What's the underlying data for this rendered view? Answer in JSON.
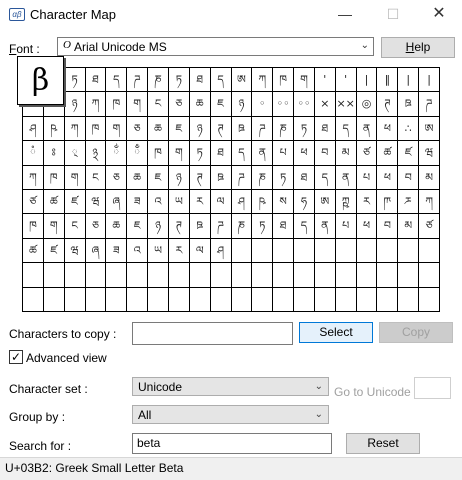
{
  "window": {
    "title": "Character Map",
    "icon_label": "αβ",
    "minimize_glyph": "—",
    "maximize_glyph": "☐",
    "close_glyph": "✕"
  },
  "font": {
    "label": "Font :",
    "label_accel": "F",
    "label_rest": "ont :",
    "type_glyph": "O",
    "selected": "Arial Unicode MS",
    "help_label": "Help",
    "help_accel": "H",
    "help_rest": "elp"
  },
  "grid": {
    "zoomed_char": "β",
    "cells": [
      "",
      "",
      "ཏ",
      "ཐ",
      "ད",
      "ཌ",
      "ཎ",
      "ཏ",
      "ཐ",
      "ད",
      "ཨ",
      "ཀ",
      "ཁ",
      "ག",
      "'",
      "'",
      "|",
      "‖",
      "|",
      "|",
      "",
      "",
      "ཉ",
      "ཀ",
      "ཁ",
      "ག",
      "ང",
      "ཅ",
      "ཆ",
      "ཇ",
      "ཉ",
      "◦",
      "◦◦",
      "◦◦",
      "×",
      "××",
      "◎",
      "ཊ",
      "ཋ",
      "ཌ",
      "ཤ",
      "ཥ",
      "ཀ",
      "ཁ",
      "ག",
      "ཅ",
      "ཆ",
      "ཇ",
      "ཉ",
      "ཊ",
      "ཋ",
      "ཌ",
      "ཎ",
      "ཏ",
      "ཐ",
      "ད",
      "ན",
      "ཕ",
      "∴",
      "ཨ",
      "ཾ",
      "ཿ",
      "྄",
      "྅",
      "ྂ",
      "ྃ",
      "ཁ",
      "ག",
      "ཏ",
      "ཐ",
      "ད",
      "ན",
      "པ",
      "ཕ",
      "བ",
      "མ",
      "ཙ",
      "ཚ",
      "ཛ",
      "ཝ",
      "ཀ",
      "ཁ",
      "ག",
      "ང",
      "ཅ",
      "ཆ",
      "ཇ",
      "ཉ",
      "ཊ",
      "ཋ",
      "ཌ",
      "ཎ",
      "ཏ",
      "ཐ",
      "ད",
      "ན",
      "པ",
      "ཕ",
      "བ",
      "མ",
      "ཙ",
      "ཚ",
      "ཛ",
      "ཝ",
      "ཞ",
      "ཟ",
      "འ",
      "ཡ",
      "ར",
      "ལ",
      "ཤ",
      "ཥ",
      "ས",
      "ཧ",
      "ཨ",
      "ཀྵ",
      "ཪ",
      "ཫ",
      "ཬ",
      "ཀ",
      "ཁ",
      "ག",
      "ང",
      "ཅ",
      "ཆ",
      "ཇ",
      "ཉ",
      "ཊ",
      "ཋ",
      "ཌ",
      "ཎ",
      "ཏ",
      "ཐ",
      "ད",
      "ན",
      "པ",
      "ཕ",
      "བ",
      "མ",
      "ཙ",
      "ཚ",
      "ཛ",
      "ཝ",
      "ཞ",
      "ཟ",
      "འ",
      "ཡ",
      "ར",
      "ལ",
      "ཤ",
      "",
      "",
      "",
      "",
      "",
      "",
      "",
      "",
      "",
      "",
      "",
      "",
      "",
      "",
      "",
      "",
      "",
      "",
      "",
      "",
      "",
      "",
      "",
      "",
      "",
      "",
      "",
      "",
      "",
      "",
      "",
      "",
      "",
      "",
      "",
      "",
      "",
      "",
      "",
      "",
      "",
      "",
      "",
      "",
      "",
      "",
      "",
      "",
      "",
      ""
    ]
  },
  "copy": {
    "label": "Characters to copy :",
    "label_accel": "h",
    "value": "",
    "select_label": "Select",
    "select_accel": "S",
    "copy_label": "Copy",
    "copy_accel": "C"
  },
  "advanced": {
    "checked": true,
    "check_glyph": "✓",
    "label": "Advanced view",
    "label_accel": "A"
  },
  "charset": {
    "label": "Character set :",
    "selected": "Unicode",
    "goto_label": "Go to Unicode :",
    "goto_value": ""
  },
  "groupby": {
    "label": "Group by :",
    "selected": "All"
  },
  "search": {
    "label": "Search for :",
    "value": "beta",
    "reset_label": "Reset"
  },
  "status": {
    "text": "U+03B2: Greek Small Letter Beta"
  },
  "colors": {
    "select_border": "#0078d7",
    "disabled_text": "#a0a0a0"
  }
}
